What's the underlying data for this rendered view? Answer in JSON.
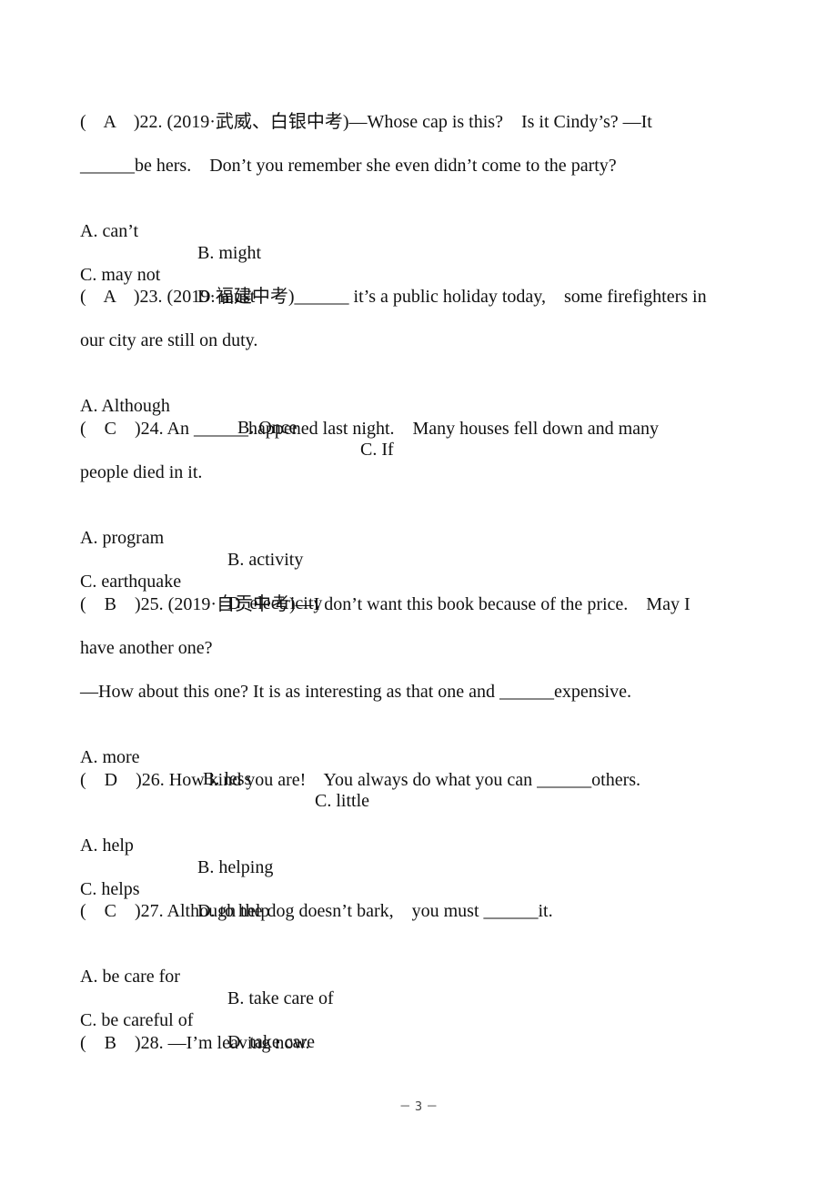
{
  "questions": [
    {
      "number": "22",
      "answer": "A",
      "lines": [
        "(    A    )22. (2019·武威、白银中考)—Whose cap is this?    Is it Cindy’s? —It",
        "______be hers.    Don’t you remember she even didn’t come to the party?"
      ],
      "options": [
        [
          "A. can’t",
          "B. might"
        ],
        [
          "C. may not",
          "D. must"
        ]
      ]
    },
    {
      "number": "23",
      "answer": "A",
      "lines": [
        "(    A    )23. (2019·福建中考)______ it’s a public holiday today,    some firefighters in",
        "our city are still on duty."
      ],
      "options": [
        [
          "A. Although",
          "B. Once",
          "C. If"
        ]
      ]
    },
    {
      "number": "24",
      "answer": "C",
      "lines": [
        "(    C    )24. An ______happened last night.    Many houses fell down and many",
        "people died in it."
      ],
      "options": [
        [
          "A. program",
          "B. activity"
        ],
        [
          "C. earthquake",
          "D. electricity"
        ]
      ]
    },
    {
      "number": "25",
      "answer": "B",
      "lines": [
        "(    B    )25. (2019·自贡中考)—I don’t want this book because of the price.    May I",
        "have another one?",
        "—How about this one? It is as interesting as that one and ______expensive."
      ],
      "options": [
        [
          "A. more",
          "B. less",
          "C. little"
        ]
      ]
    },
    {
      "number": "26",
      "answer": "D",
      "lines": [
        "(    D    )26. How kind you are!    You always do what you can ______others."
      ],
      "options": [
        [
          "A. help",
          "B. helping"
        ],
        [
          "C. helps",
          "D. to help"
        ]
      ]
    },
    {
      "number": "27",
      "answer": "C",
      "lines": [
        "(    C    )27. Although the dog doesn’t bark,    you must ______it."
      ],
      "options": [
        [
          "A. be care for",
          "B. take care of"
        ],
        [
          "C. be careful of",
          "D. take care"
        ]
      ]
    },
    {
      "number": "28",
      "answer": "B",
      "lines": [
        "(    B    )28. —I’m leaving now."
      ],
      "options": []
    }
  ],
  "footer": {
    "page_label": "－ 3 －"
  }
}
